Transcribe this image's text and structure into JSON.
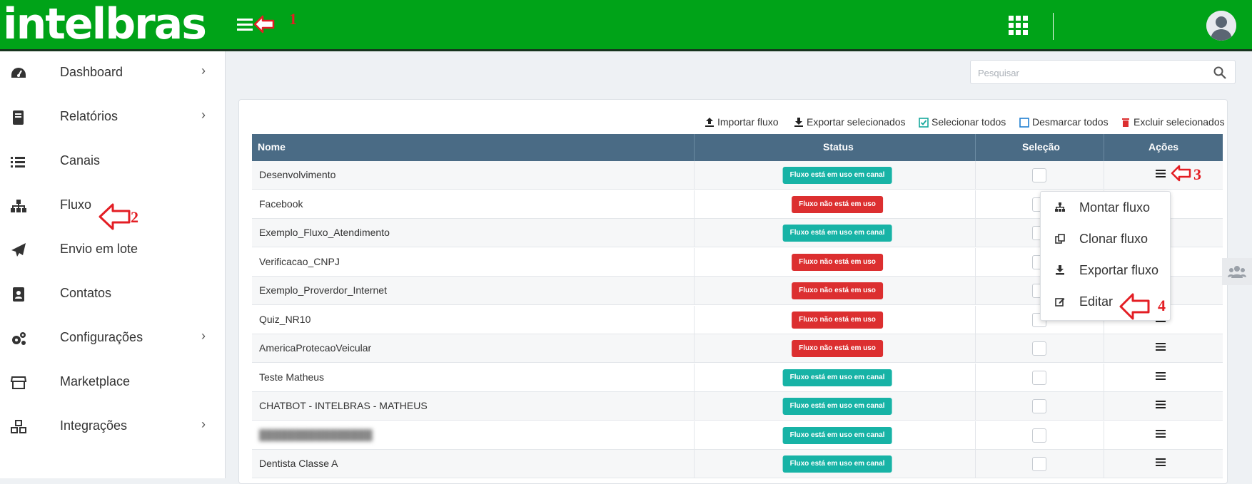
{
  "header": {
    "logo_text": "intelbras",
    "brand_color": "#00a318",
    "menu_icon": "hamburger-icon",
    "apps_icon": "grid-icon",
    "avatar_icon": "user-avatar-icon"
  },
  "annotations": [
    "1",
    "2",
    "3",
    "4"
  ],
  "sidebar": {
    "items": [
      {
        "label": "Dashboard",
        "icon": "gauge-icon",
        "has_submenu": true
      },
      {
        "label": "Relatórios",
        "icon": "book-icon",
        "has_submenu": true
      },
      {
        "label": "Canais",
        "icon": "list-icon",
        "has_submenu": false
      },
      {
        "label": "Fluxo",
        "icon": "sitemap-icon",
        "has_submenu": false
      },
      {
        "label": "Envio em lote",
        "icon": "paper-plane-icon",
        "has_submenu": false
      },
      {
        "label": "Contatos",
        "icon": "address-book-icon",
        "has_submenu": false
      },
      {
        "label": "Configurações",
        "icon": "cogs-icon",
        "has_submenu": true
      },
      {
        "label": "Marketplace",
        "icon": "store-icon",
        "has_submenu": false
      },
      {
        "label": "Integrações",
        "icon": "cubes-icon",
        "has_submenu": true
      }
    ]
  },
  "search": {
    "placeholder": "Pesquisar"
  },
  "toolbar": {
    "import": "Importar fluxo",
    "export_selected": "Exportar selecionados",
    "select_all": "Selecionar todos",
    "unselect_all": "Desmarcar todos",
    "delete_selected": "Excluir selecionados"
  },
  "table": {
    "columns": [
      "Nome",
      "Status",
      "Seleção",
      "Ações"
    ],
    "status_labels": {
      "in_use": "Fluxo está em uso em canal",
      "not_in_use": "Fluxo não está em uso"
    },
    "status_colors": {
      "in_use": "#17b3a6",
      "not_in_use": "#dc2f30"
    },
    "rows": [
      {
        "name": "Desenvolvimento",
        "status": "Fluxo está em uso em canal",
        "in_use": true,
        "blurred": false
      },
      {
        "name": "Facebook",
        "status": "Fluxo não está em uso",
        "in_use": false,
        "blurred": false
      },
      {
        "name": "Exemplo_Fluxo_Atendimento",
        "status": "Fluxo está em uso em canal",
        "in_use": true,
        "blurred": false
      },
      {
        "name": "Verificacao_CNPJ",
        "status": "Fluxo não está em uso",
        "in_use": false,
        "blurred": false
      },
      {
        "name": "Exemplo_Proverdor_Internet",
        "status": "Fluxo não está em uso",
        "in_use": false,
        "blurred": false
      },
      {
        "name": "Quiz_NR10",
        "status": "Fluxo não está em uso",
        "in_use": false,
        "blurred": false
      },
      {
        "name": "AmericaProtecaoVeicular",
        "status": "Fluxo não está em uso",
        "in_use": false,
        "blurred": false
      },
      {
        "name": "Teste Matheus",
        "status": "Fluxo está em uso em canal",
        "in_use": true,
        "blurred": false
      },
      {
        "name": "CHATBOT - INTELBRAS - MATHEUS",
        "status": "Fluxo está em uso em canal",
        "in_use": true,
        "blurred": false
      },
      {
        "name": "",
        "status": "Fluxo está em uso em canal",
        "in_use": true,
        "blurred": true
      },
      {
        "name": "Dentista Classe A",
        "status": "Fluxo está em uso em canal",
        "in_use": true,
        "blurred": false
      }
    ]
  },
  "row_menu": {
    "items": [
      {
        "label": "Montar fluxo",
        "icon": "sitemap-icon"
      },
      {
        "label": "Clonar fluxo",
        "icon": "copy-icon"
      },
      {
        "label": "Exportar fluxo",
        "icon": "download-icon"
      },
      {
        "label": "Editar",
        "icon": "edit-icon"
      }
    ]
  }
}
